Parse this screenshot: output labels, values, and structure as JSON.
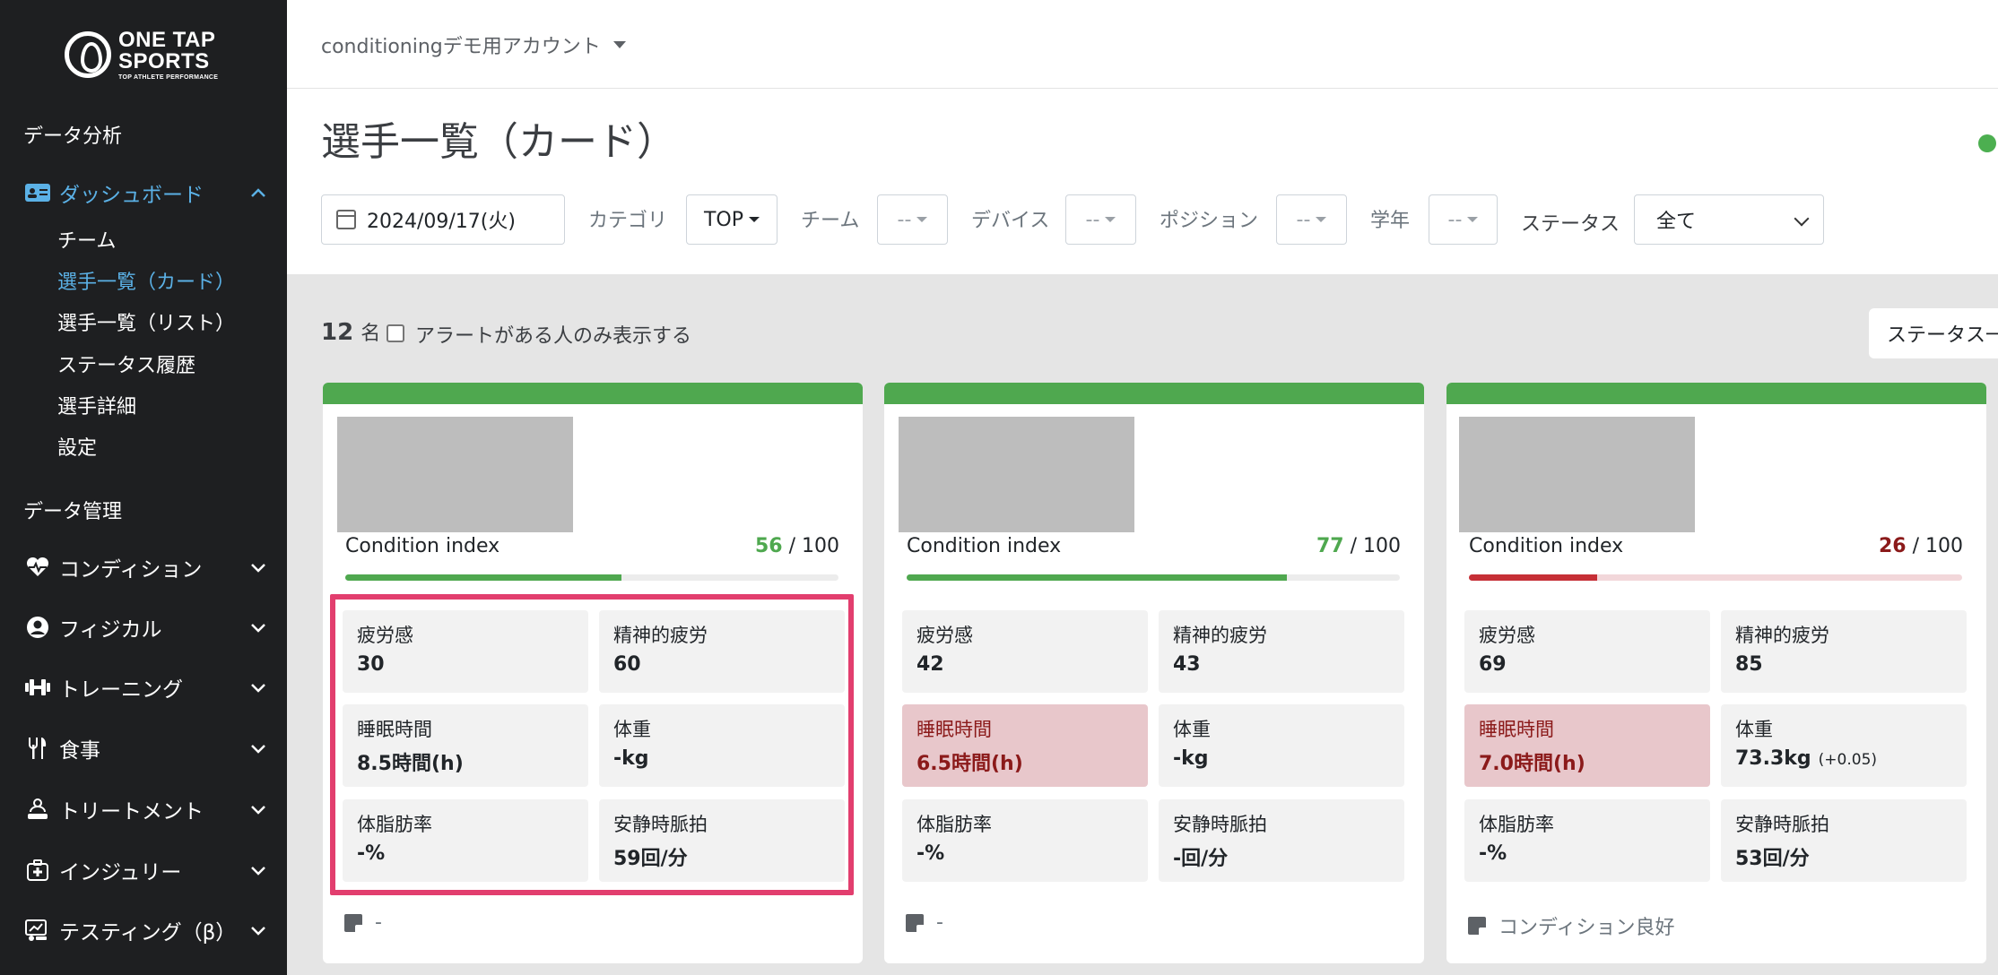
{
  "brand": {
    "line1": "ONE TAP",
    "line2": "SPORTS",
    "tagline": "TOP ATHLETE PERFORMANCE"
  },
  "sidebar": {
    "section_analysis": "データ分析",
    "dashboard": {
      "label": "ダッシュボード",
      "icon": "id-card-icon"
    },
    "dashboard_children": [
      {
        "label": "チーム"
      },
      {
        "label": "選手一覧（カード）"
      },
      {
        "label": "選手一覧（リスト）"
      },
      {
        "label": "ステータス履歴"
      },
      {
        "label": "選手詳細"
      },
      {
        "label": "設定"
      }
    ],
    "section_data": "データ管理",
    "groups": [
      {
        "label": "コンディション",
        "icon": "heartbeat-icon"
      },
      {
        "label": "フィジカル",
        "icon": "user-circle-icon"
      },
      {
        "label": "トレーニング",
        "icon": "dumbbell-icon"
      },
      {
        "label": "食事",
        "icon": "utensils-icon"
      },
      {
        "label": "トリートメント",
        "icon": "treatment-icon"
      },
      {
        "label": "インジュリー",
        "icon": "medkit-icon"
      },
      {
        "label": "テスティング（β）",
        "icon": "chart-test-icon"
      }
    ]
  },
  "header": {
    "account": "conditioningデモ用アカウント"
  },
  "page": {
    "title": "選手一覧（カード）"
  },
  "filters": {
    "date": "2024/09/17(火)",
    "category_label": "カテゴリ",
    "category_value": "TOP",
    "team_label": "チーム",
    "team_value": "--",
    "device_label": "デバイス",
    "device_value": "--",
    "position_label": "ポジション",
    "position_value": "--",
    "grade_label": "学年",
    "grade_value": "--",
    "status_label": "ステータス",
    "status_value": "全て"
  },
  "list": {
    "count": "12",
    "count_unit": "名",
    "alert_only_label": "アラートがある人のみ表示する",
    "status_button": "ステータス一"
  },
  "colors": {
    "accent": "#5bb1e6",
    "good": "#4fa84f",
    "bad": "#8b1a1a",
    "alert_bg": "#e8c7cb",
    "highlight": "#e23e6e"
  },
  "cards": [
    {
      "ci_label": "Condition index",
      "ci_value": "56",
      "ci_max": "/ 100",
      "ci_fraction": 0.56,
      "ci_status": "good",
      "metrics": [
        {
          "label": "疲労感",
          "value": "30",
          "alert": false
        },
        {
          "label": "精神的疲労",
          "value": "60",
          "alert": false
        },
        {
          "label": "睡眠時間",
          "value": "8.5時間(h)",
          "alert": false
        },
        {
          "label": "体重",
          "value": "-kg",
          "alert": false
        },
        {
          "label": "体脂肪率",
          "value": "-%",
          "alert": false
        },
        {
          "label": "安静時脈拍",
          "value": "59回/分",
          "alert": false
        }
      ],
      "memo": "-"
    },
    {
      "ci_label": "Condition index",
      "ci_value": "77",
      "ci_max": "/ 100",
      "ci_fraction": 0.77,
      "ci_status": "good",
      "metrics": [
        {
          "label": "疲労感",
          "value": "42",
          "alert": false
        },
        {
          "label": "精神的疲労",
          "value": "43",
          "alert": false
        },
        {
          "label": "睡眠時間",
          "value": "6.5時間(h)",
          "alert": true
        },
        {
          "label": "体重",
          "value": "-kg",
          "alert": false
        },
        {
          "label": "体脂肪率",
          "value": "-%",
          "alert": false
        },
        {
          "label": "安静時脈拍",
          "value": "-回/分",
          "alert": false
        }
      ],
      "memo": "-"
    },
    {
      "ci_label": "Condition index",
      "ci_value": "26",
      "ci_max": "/ 100",
      "ci_fraction": 0.26,
      "ci_status": "bad",
      "metrics": [
        {
          "label": "疲労感",
          "value": "69",
          "alert": false
        },
        {
          "label": "精神的疲労",
          "value": "85",
          "alert": false
        },
        {
          "label": "睡眠時間",
          "value": "7.0時間(h)",
          "alert": true
        },
        {
          "label": "体重",
          "value": "73.3kg",
          "sub": "(+0.05)",
          "alert": false
        },
        {
          "label": "体脂肪率",
          "value": "-%",
          "alert": false
        },
        {
          "label": "安静時脈拍",
          "value": "53回/分",
          "alert": false
        }
      ],
      "memo": "コンディション良好"
    }
  ]
}
